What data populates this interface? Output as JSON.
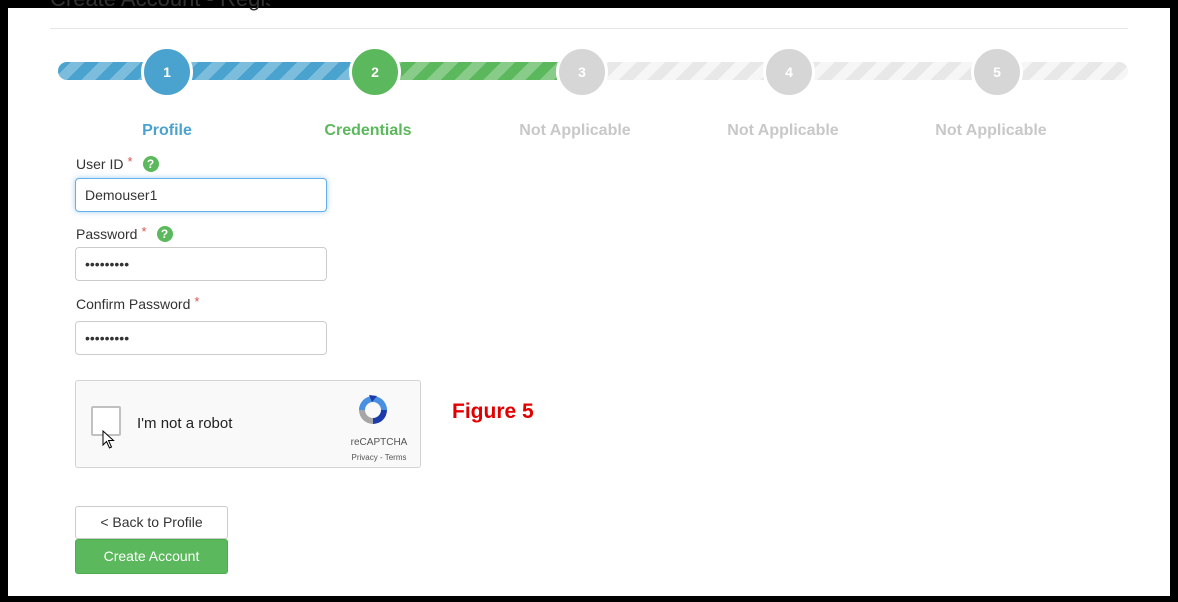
{
  "heading_fragment": "Create Account - Registration",
  "steps": [
    {
      "number": "1",
      "label": "Profile",
      "state": "completed",
      "color": "#4aa3cf"
    },
    {
      "number": "2",
      "label": "Credentials",
      "state": "active",
      "color": "#5cb85c"
    },
    {
      "number": "3",
      "label": "Not Applicable",
      "state": "disabled",
      "color": "#d6d6d6"
    },
    {
      "number": "4",
      "label": "Not Applicable",
      "state": "disabled",
      "color": "#d6d6d6"
    },
    {
      "number": "5",
      "label": "Not Applicable",
      "state": "disabled",
      "color": "#d6d6d6"
    }
  ],
  "form": {
    "user_id": {
      "label": "User ID",
      "required_mark": "*",
      "help_icon": "question-circle-icon",
      "value": "Demouser1"
    },
    "password": {
      "label": "Password",
      "required_mark": "*",
      "help_icon": "question-circle-icon",
      "value": "•••••••••"
    },
    "confirm_password": {
      "label": "Confirm Password",
      "required_mark": "*",
      "value": "•••••••••"
    }
  },
  "recaptcha": {
    "label": "I'm not a robot",
    "brand": "reCAPTCHA",
    "links": "Privacy - Terms"
  },
  "figure_label": "Figure 5",
  "buttons": {
    "back": "< Back to Profile",
    "create": "Create Account"
  },
  "colors": {
    "completed": "#4aa3cf",
    "active": "#5cb85c",
    "disabled": "#d6d6d6",
    "required": "#d9534f",
    "figure_label": "#e00000"
  }
}
